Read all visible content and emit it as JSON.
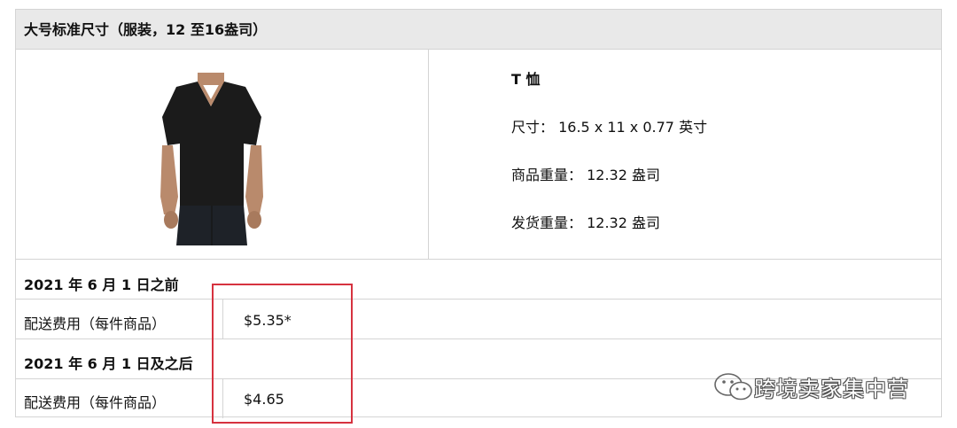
{
  "header": {
    "title": "大号标准尺寸（服装，12 至16盎司）"
  },
  "product": {
    "image_icon": "black-v-neck-tshirt-image",
    "name": "T 恤",
    "dimensions": "尺寸：  16.5 x 11 x 0.77 英寸",
    "item_weight": "商品重量：  12.32 盎司",
    "shipping_weight": "发货重量：  12.32 盎司"
  },
  "sections": [
    {
      "heading": "2021 年 6 月 1 日之前",
      "fee_label": "配送费用（每件商品）",
      "fee_value": "$5.35*"
    },
    {
      "heading": "2021 年 6 月 1 日及之后",
      "fee_label": "配送费用（每件商品）",
      "fee_value": "$4.65"
    }
  ],
  "highlight_color": "#d6323f",
  "watermark": {
    "icon": "wechat-icon",
    "text": "跨境卖家集中营"
  }
}
